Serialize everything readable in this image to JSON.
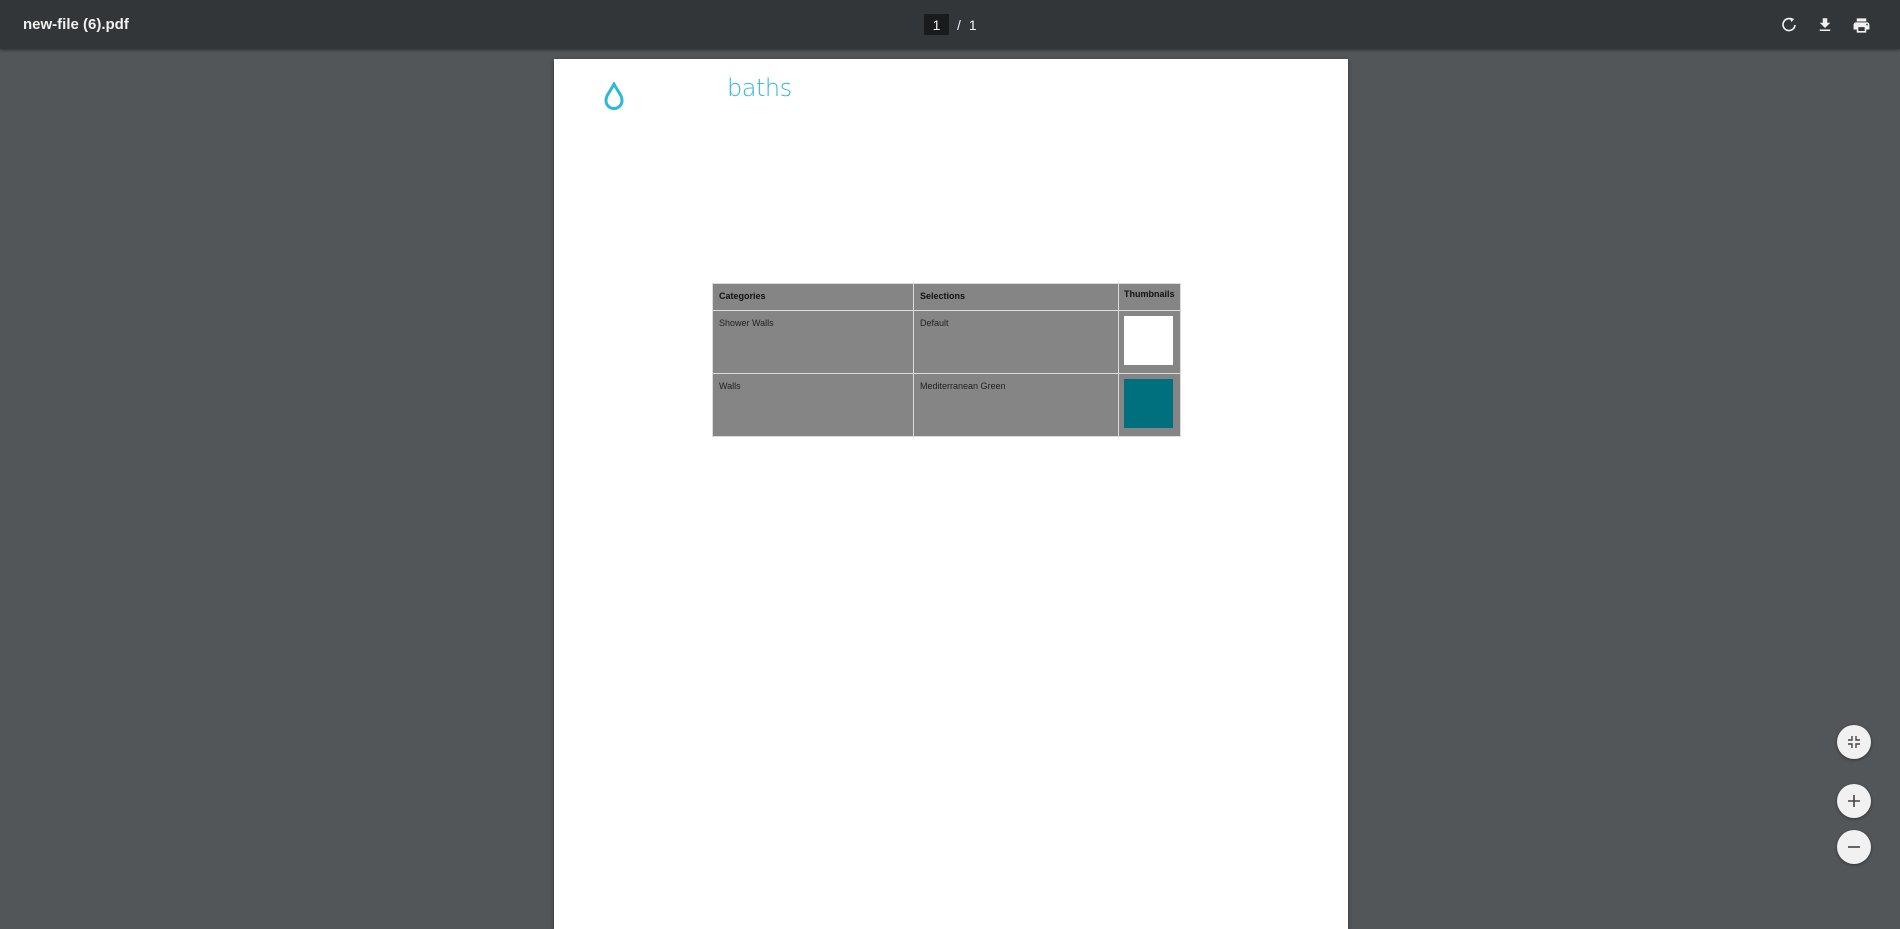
{
  "toolbar": {
    "title": "new-file (6).pdf",
    "page_current": "1",
    "page_separator": "/",
    "page_total": "1",
    "actions": [
      {
        "name": "rotate-icon"
      },
      {
        "name": "download-icon"
      },
      {
        "name": "print-icon"
      }
    ]
  },
  "document": {
    "brand_text": "baths",
    "brand_color": "#2cb8d6",
    "table": {
      "headers": [
        "Categories",
        "Selections",
        "Thumbnails"
      ],
      "rows": [
        {
          "category": "Shower Walls",
          "selection": "Default",
          "thumb_color": "#ffffff"
        },
        {
          "category": "Walls",
          "selection": "Mediterranean Green",
          "thumb_color": "#00707f"
        }
      ]
    }
  },
  "zoom_controls": [
    {
      "name": "fit-page-icon"
    },
    {
      "name": "zoom-in-icon"
    },
    {
      "name": "zoom-out-icon"
    }
  ]
}
